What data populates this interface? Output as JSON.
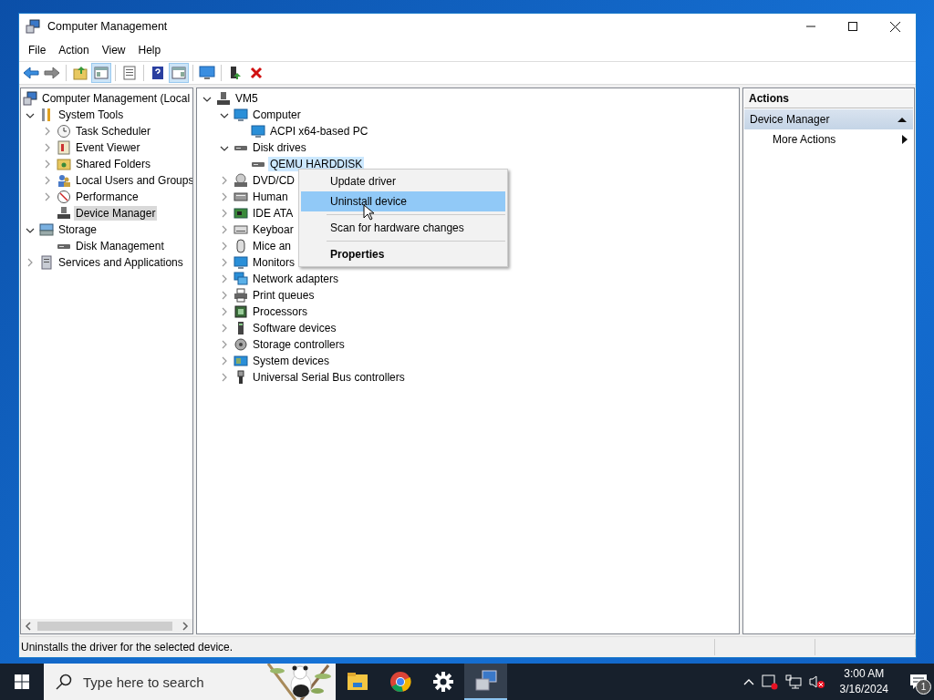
{
  "window": {
    "title": "Computer Management"
  },
  "menu_bar": [
    "File",
    "Action",
    "View",
    "Help"
  ],
  "toolbar": {
    "buttons": [
      {
        "kind": "back",
        "pressed": false
      },
      {
        "kind": "forward",
        "pressed": false
      },
      {
        "kind": "separator"
      },
      {
        "kind": "up",
        "pressed": false
      },
      {
        "kind": "tree",
        "pressed": true
      },
      {
        "kind": "separator"
      },
      {
        "kind": "properties",
        "pressed": false
      },
      {
        "kind": "separator"
      },
      {
        "kind": "help",
        "pressed": false
      },
      {
        "kind": "actionpane",
        "pressed": true
      },
      {
        "kind": "separator"
      },
      {
        "kind": "scan",
        "pressed": false
      },
      {
        "kind": "separator"
      },
      {
        "kind": "update",
        "pressed": false
      },
      {
        "kind": "remove",
        "pressed": false
      }
    ]
  },
  "console_tree": {
    "items": [
      {
        "label": "Computer Management (Local",
        "selected": false,
        "children": [
          {
            "label": "System Tools",
            "expanded": true,
            "selected": false,
            "children": [
              {
                "label": "Task Scheduler",
                "expanded": false,
                "selected": false
              },
              {
                "label": "Event Viewer",
                "expanded": false,
                "selected": false
              },
              {
                "label": "Shared Folders",
                "expanded": false,
                "selected": false
              },
              {
                "label": "Local Users and Groups",
                "expanded": false,
                "selected": false
              },
              {
                "label": "Performance",
                "expanded": false,
                "selected": false
              },
              {
                "label": "Device Manager",
                "selected": true
              }
            ]
          },
          {
            "label": "Storage",
            "expanded": true,
            "selected": false,
            "children": [
              {
                "label": "Disk Management",
                "selected": false
              }
            ]
          },
          {
            "label": "Services and Applications",
            "expanded": false,
            "selected": false
          }
        ]
      }
    ]
  },
  "device_tree": {
    "items": [
      {
        "label": "VM5",
        "expanded": true,
        "selected": false,
        "children": [
          {
            "label": "Computer",
            "expanded": true,
            "selected": false,
            "children": [
              {
                "label": "ACPI x64-based PC",
                "selected": false
              }
            ]
          },
          {
            "label": "Disk drives",
            "expanded": true,
            "selected": false,
            "children": [
              {
                "label": "QEMU HARDDISK",
                "selected": true
              }
            ]
          },
          {
            "label": "DVD/CD",
            "expanded": false,
            "selected": false
          },
          {
            "label": "Human",
            "expanded": false,
            "selected": false
          },
          {
            "label": "IDE ATA",
            "expanded": false,
            "selected": false
          },
          {
            "label": "Keyboar",
            "expanded": false,
            "selected": false
          },
          {
            "label": "Mice an",
            "expanded": false,
            "selected": false
          },
          {
            "label": "Monitors",
            "expanded": false,
            "selected": false
          },
          {
            "label": "Network adapters",
            "expanded": false,
            "selected": false
          },
          {
            "label": "Print queues",
            "expanded": false,
            "selected": false
          },
          {
            "label": "Processors",
            "expanded": false,
            "selected": false
          },
          {
            "label": "Software devices",
            "expanded": false,
            "selected": false
          },
          {
            "label": "Storage controllers",
            "expanded": false,
            "selected": false
          },
          {
            "label": "System devices",
            "expanded": false,
            "selected": false
          },
          {
            "label": "Universal Serial Bus controllers",
            "expanded": false,
            "selected": false
          }
        ]
      }
    ]
  },
  "context_menu": {
    "items": [
      {
        "kind": "item",
        "label": "Update driver",
        "selected": false
      },
      {
        "kind": "item",
        "label": "Uninstall device",
        "selected": true
      },
      {
        "kind": "separator"
      },
      {
        "kind": "item",
        "label": "Scan for hardware changes",
        "selected": false
      },
      {
        "kind": "separator"
      },
      {
        "kind": "default",
        "label": "Properties",
        "selected": false
      }
    ]
  },
  "actions_pane": {
    "title": "Actions",
    "section": {
      "label": "Device Manager",
      "expanded": true
    },
    "items": [
      {
        "label": "More Actions",
        "submenu": true
      }
    ]
  },
  "status_bar": "Uninstalls the driver for the selected device.",
  "taskbar": {
    "search": {
      "placeholder": "Type here to search"
    },
    "apps": [
      {
        "kind": "explorer",
        "active": false
      },
      {
        "kind": "browser",
        "active": false
      },
      {
        "kind": "settings",
        "active": false
      },
      {
        "kind": "manager",
        "active": true
      }
    ],
    "time": "3:00 AM",
    "date": "3/16/2024",
    "notifications": "1"
  }
}
